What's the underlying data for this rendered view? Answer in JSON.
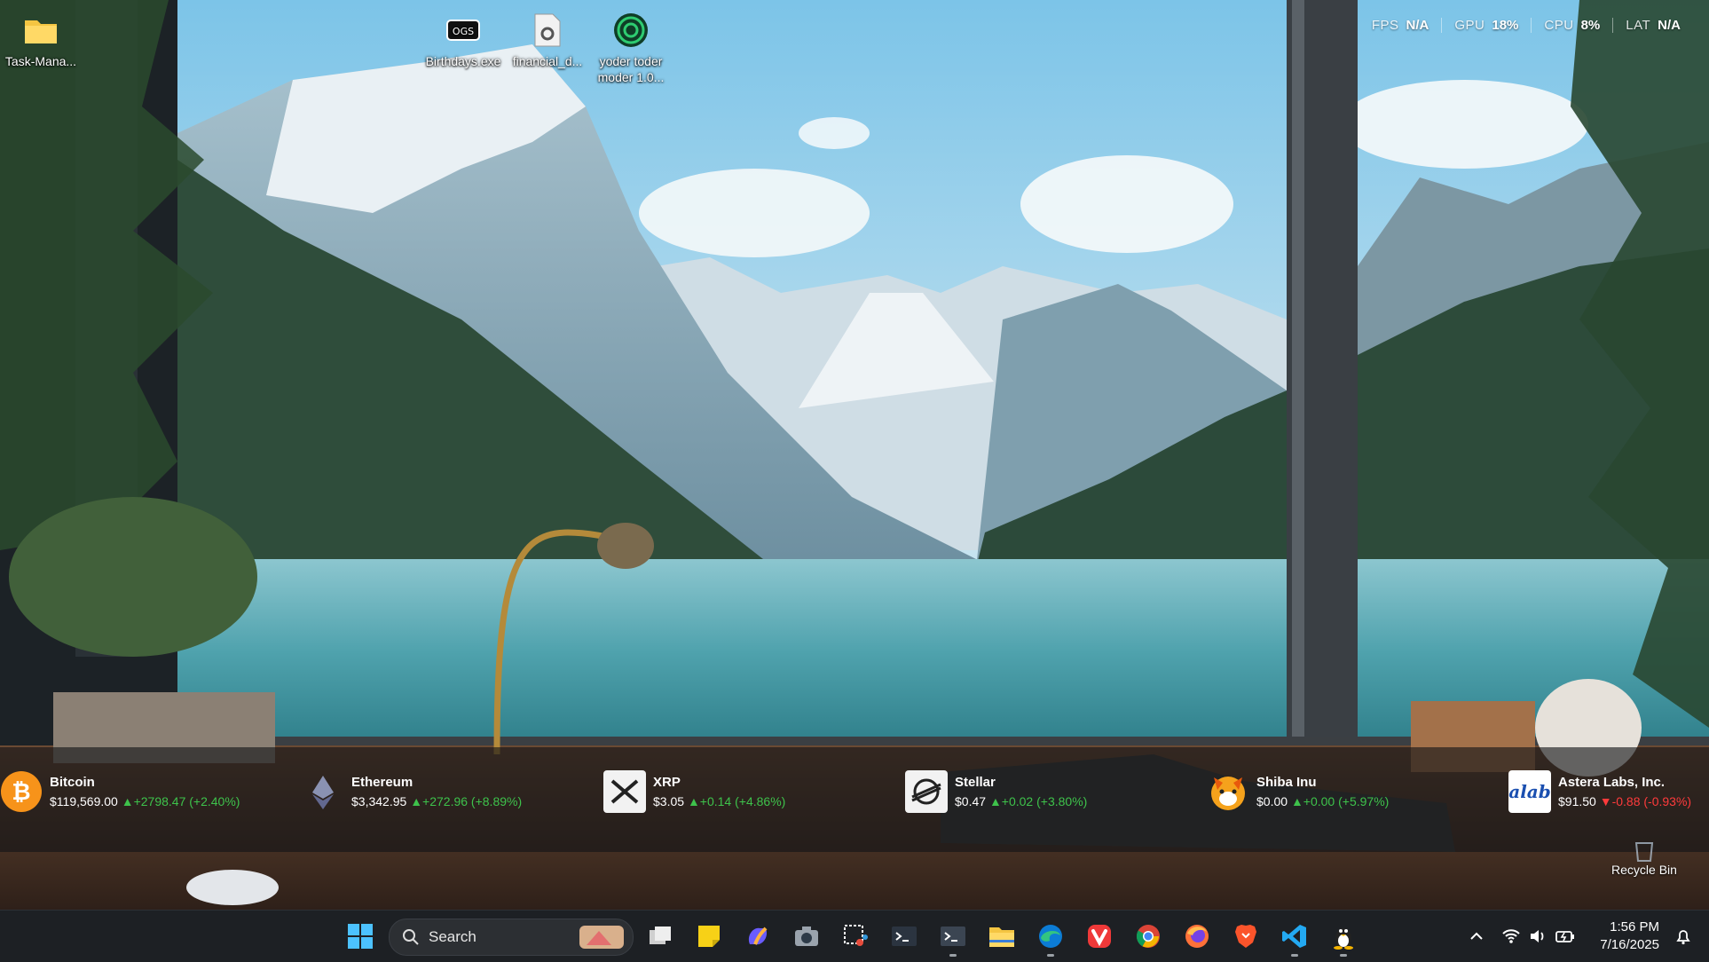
{
  "desktop": {
    "icons": [
      {
        "label": "Task-Mana...",
        "icon": "folder-icon"
      },
      {
        "label": "Birthdays.exe",
        "icon": "ogs-icon"
      },
      {
        "label": "financial_d...",
        "icon": "gear-file-icon"
      },
      {
        "label": "yoder toder moder 1.0...",
        "icon": "green-circle-app-icon"
      }
    ],
    "recycle_bin": "Recycle Bin"
  },
  "perf_overlay": [
    {
      "key": "FPS",
      "value": "N/A"
    },
    {
      "key": "GPU",
      "value": "18%"
    },
    {
      "key": "CPU",
      "value": "8%"
    },
    {
      "key": "LAT",
      "value": "N/A"
    }
  ],
  "ticker": [
    {
      "name": "Bitcoin",
      "price": "$119,569.00",
      "change": "▲+2798.47 (+2.40%)",
      "direction": "up",
      "icon": "bitcoin-icon"
    },
    {
      "name": "Ethereum",
      "price": "$3,342.95",
      "change": "▲+272.96 (+8.89%)",
      "direction": "up",
      "icon": "ethereum-icon"
    },
    {
      "name": "XRP",
      "price": "$3.05",
      "change": "▲+0.14 (+4.86%)",
      "direction": "up",
      "icon": "xrp-icon"
    },
    {
      "name": "Stellar",
      "price": "$0.47",
      "change": "▲+0.02 (+3.80%)",
      "direction": "up",
      "icon": "stellar-icon"
    },
    {
      "name": "Shiba Inu",
      "price": "$0.00",
      "change": "▲+0.00 (+5.97%)",
      "direction": "up",
      "icon": "shiba-inu-icon"
    },
    {
      "name": "Astera Labs, Inc.",
      "price": "$91.50",
      "change": "▼-0.88 (-0.93%)",
      "direction": "down",
      "icon": "alab-icon"
    }
  ],
  "ticker_logo_text": {
    "alab": "alab"
  },
  "taskbar": {
    "search_label": "Search",
    "apps": [
      "start-icon",
      "task-view-icon",
      "sticky-notes-icon",
      "copilot-icon",
      "camera-icon",
      "snipping-tool-icon",
      "terminal-icon",
      "terminal-preview-icon",
      "file-explorer-icon",
      "edge-icon",
      "vivaldi-icon",
      "chrome-icon",
      "firefox-icon",
      "brave-icon",
      "vscode-icon",
      "linux-tux-icon"
    ],
    "time": "1:56 PM",
    "date": "7/16/2025"
  },
  "colors": {
    "up": "#3ec24b",
    "down": "#ff3b3b",
    "taskbar": "#1d2024"
  }
}
